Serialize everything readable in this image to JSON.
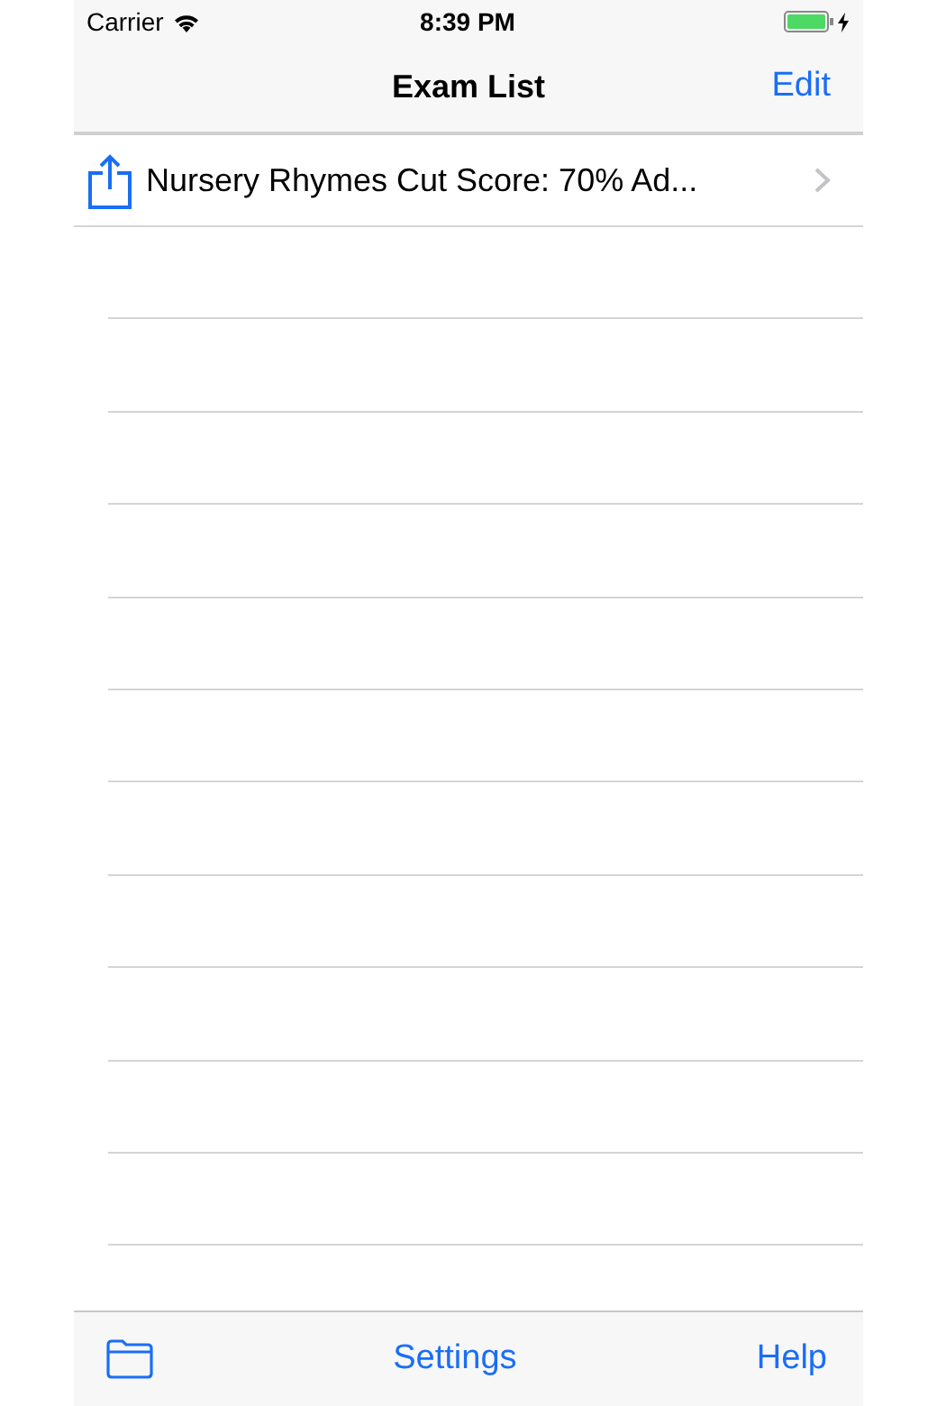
{
  "status_bar": {
    "carrier": "Carrier",
    "time": "8:39 PM",
    "charging": true
  },
  "nav_bar": {
    "title": "Exam List",
    "right_button": "Edit"
  },
  "exams": [
    {
      "title": "Nursery Rhymes Cut Score: 70% Ad..."
    }
  ],
  "toolbar": {
    "center_button": "Settings",
    "right_button": "Help"
  }
}
